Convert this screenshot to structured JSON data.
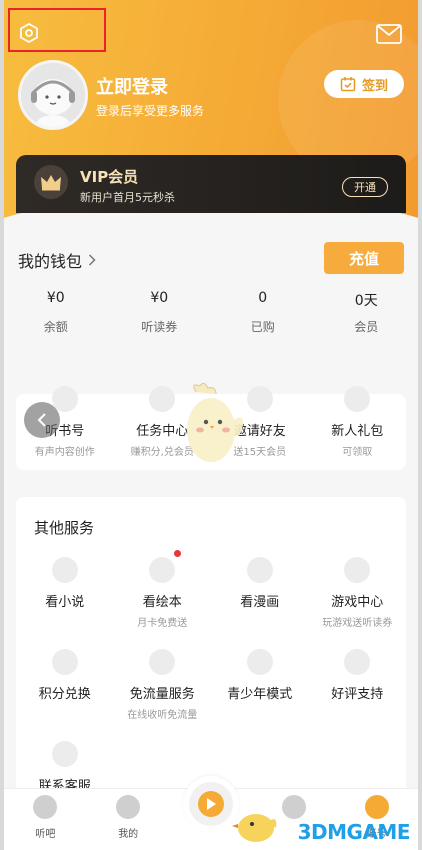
{
  "header": {
    "login_title": "立即登录",
    "login_subtitle": "登录后享受更多服务",
    "signin_label": "签到"
  },
  "vip": {
    "title": "VIP会员",
    "subtitle": "新用户首月5元秒杀",
    "open_label": "开通"
  },
  "wallet": {
    "title": "我的钱包",
    "recharge_label": "充值",
    "items": [
      {
        "value": "¥0",
        "label": "余额"
      },
      {
        "value": "¥0",
        "label": "听读券"
      },
      {
        "value": "0",
        "label": "已购"
      },
      {
        "value": "0天",
        "label": "会员"
      }
    ]
  },
  "quick": {
    "items": [
      {
        "label": "听书号",
        "sub": "有声内容创作"
      },
      {
        "label": "任务中心",
        "sub": "赚积分,兑会员"
      },
      {
        "label": "邀请好友",
        "sub": "送15天会员"
      },
      {
        "label": "新人礼包",
        "sub": "可领取"
      }
    ]
  },
  "other": {
    "title": "其他服务",
    "row1": [
      {
        "label": "看小说",
        "sub": ""
      },
      {
        "label": "看绘本",
        "sub": "月卡免费送"
      },
      {
        "label": "看漫画",
        "sub": ""
      },
      {
        "label": "游戏中心",
        "sub": "玩游戏送听读券"
      }
    ],
    "row2": [
      {
        "label": "积分兑换",
        "sub": ""
      },
      {
        "label": "免流量服务",
        "sub": "在线收听免流量"
      },
      {
        "label": "青少年模式",
        "sub": ""
      },
      {
        "label": "好评支持",
        "sub": ""
      }
    ],
    "row3": [
      {
        "label": "联系客服",
        "sub": ""
      }
    ]
  },
  "tabbar": {
    "items": [
      {
        "label": "听吧"
      },
      {
        "label": "我的"
      },
      {
        "label": ""
      },
      {
        "label": ""
      },
      {
        "label": "账号"
      }
    ]
  },
  "watermark": "3DMGAME",
  "colors": {
    "accent": "#f5aa36",
    "vip_gold": "#f7e3b8",
    "notification_red": "#e8343a",
    "highlight_box": "#e8232a"
  }
}
